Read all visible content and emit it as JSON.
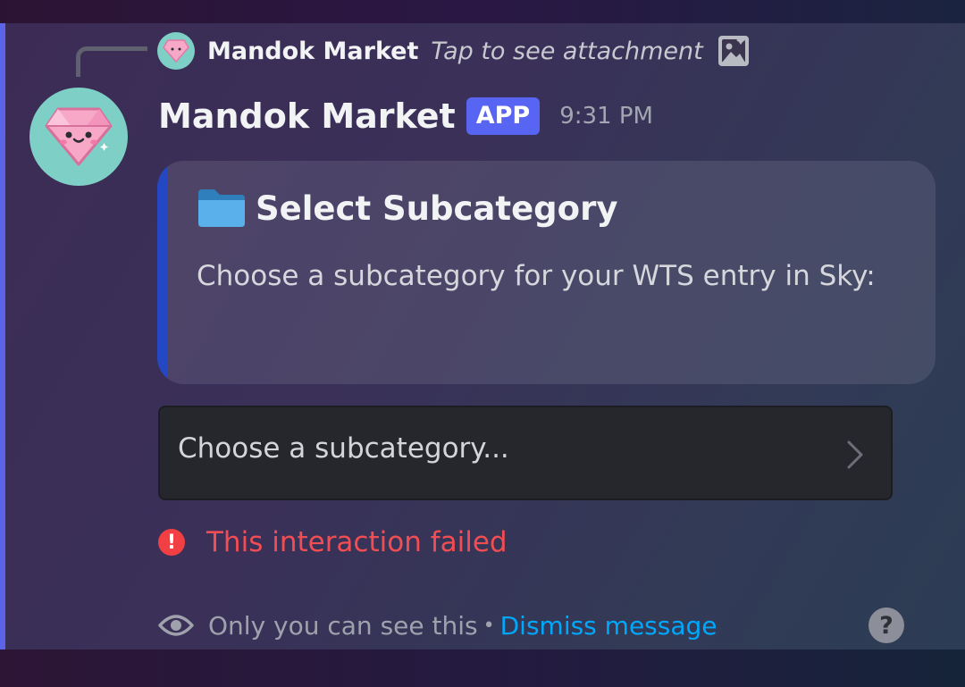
{
  "reply": {
    "author": "Mandok Market",
    "attachment_text": "Tap to see attachment"
  },
  "message": {
    "author": "Mandok Market",
    "badge": "APP",
    "timestamp": "9:31 PM"
  },
  "embed": {
    "title": "Select Subcategory",
    "description": "Choose a subcategory for your WTS entry in Sky:",
    "accent_color": "#2448c4"
  },
  "select_menu": {
    "placeholder": "Choose a subcategory..."
  },
  "error": {
    "text": "This interaction failed"
  },
  "footer": {
    "visibility_text": "Only you can see this",
    "separator": "•",
    "dismiss_label": "Dismiss message",
    "help_label": "?"
  },
  "icons": {
    "avatar": "pink-diamond-icon",
    "attachment": "image-icon",
    "embed_title": "folder-icon",
    "select": "chevron-right-icon",
    "error": "error-icon",
    "visibility": "eye-icon",
    "help": "help-icon"
  },
  "colors": {
    "brand": "#5865f2",
    "error": "#f23f43",
    "link": "#00a8fc",
    "avatar_bg": "#7ecfc6"
  }
}
